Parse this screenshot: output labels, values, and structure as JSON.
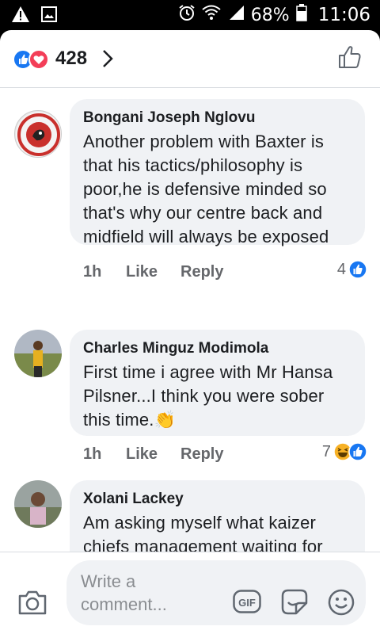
{
  "status_bar": {
    "battery_percent": "68%",
    "time": "11:06",
    "icons": [
      "warning-icon",
      "image-icon",
      "alarm-icon",
      "wifi-icon",
      "signal-icon",
      "battery-icon"
    ]
  },
  "reactions_header": {
    "count": "428",
    "icons": [
      "like-reaction-icon",
      "love-reaction-icon"
    ]
  },
  "comments": [
    {
      "author": "Bongani Joseph Nglovu",
      "text": "Another problem with Baxter is that his tactics/philosophy is poor,he is defensive minded so that's why our centre back and midfield will always be exposed",
      "time": "1h",
      "like_label": "Like",
      "reply_label": "Reply",
      "reaction_count": "4",
      "reaction_icons": [
        "like-reaction-icon"
      ]
    },
    {
      "author": "Charles Minguz Modimola",
      "text": "First time i agree with Mr Hansa Pilsner...I think you were sober this time.",
      "emoji": "👏",
      "time": "1h",
      "like_label": "Like",
      "reply_label": "Reply",
      "reaction_count": "7",
      "reaction_icons": [
        "haha-reaction-icon",
        "like-reaction-icon"
      ]
    },
    {
      "author": "Xolani Lackey",
      "text": "Am asking myself what kaizer chiefs management waiting for before firing this coach."
    }
  ],
  "composer": {
    "placeholder": "Write a comment..."
  },
  "colors": {
    "accent_blue": "#1877f2",
    "love_red": "#f33e58",
    "bubble_gray": "#f0f2f5",
    "meta_gray": "#65676b"
  }
}
